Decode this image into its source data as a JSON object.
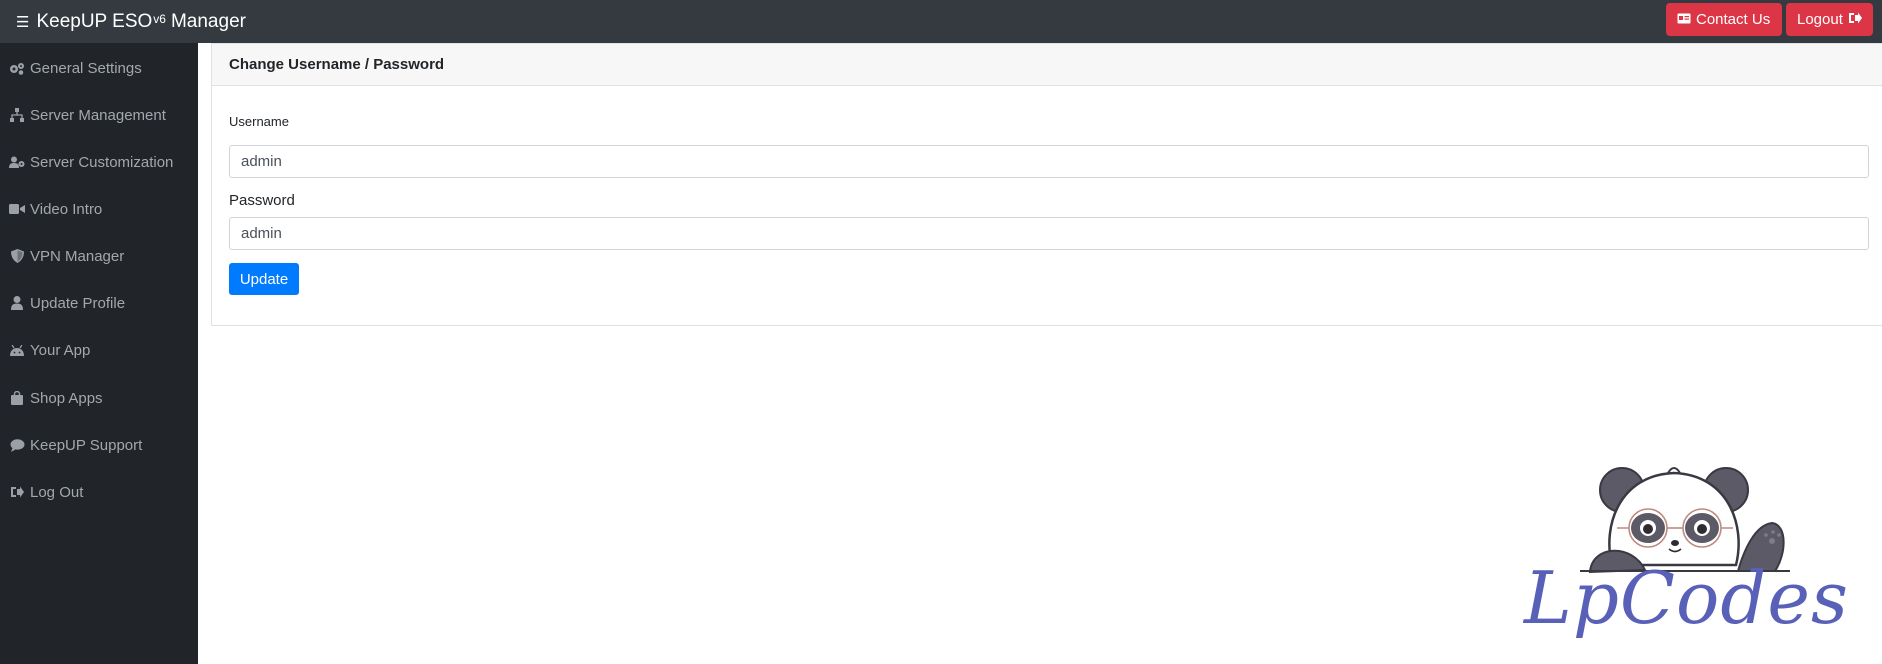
{
  "app": {
    "title_prefix": "KeepUP ESO",
    "title_sup": "v6",
    "title_suffix": "Manager",
    "menu_icon": "list-icon"
  },
  "header": {
    "contact_label": "Contact Us",
    "logout_label": "Logout",
    "accent_red": "#dc3545"
  },
  "sidebar": {
    "items": [
      {
        "label": "General Settings",
        "icon": "cogs-icon"
      },
      {
        "label": "Server Management",
        "icon": "sitemap-icon"
      },
      {
        "label": "Server Customization",
        "icon": "users-cog-icon"
      },
      {
        "label": "Video Intro",
        "icon": "video-icon"
      },
      {
        "label": "VPN Manager",
        "icon": "shield-icon"
      },
      {
        "label": "Update Profile",
        "icon": "user-icon"
      },
      {
        "label": "Your App",
        "icon": "android-icon"
      },
      {
        "label": "Shop Apps",
        "icon": "shopping-bag-icon"
      },
      {
        "label": "KeepUP Support",
        "icon": "comment-icon"
      },
      {
        "label": "Log Out",
        "icon": "sign-out-icon"
      }
    ]
  },
  "form": {
    "title": "Change Username / Password",
    "username_label": "Username",
    "username_value": "admin",
    "password_label": "Password",
    "password_value": "admin",
    "update_label": "Update",
    "primary_color": "#007bff"
  },
  "watermark": {
    "text": "LpCodes"
  }
}
